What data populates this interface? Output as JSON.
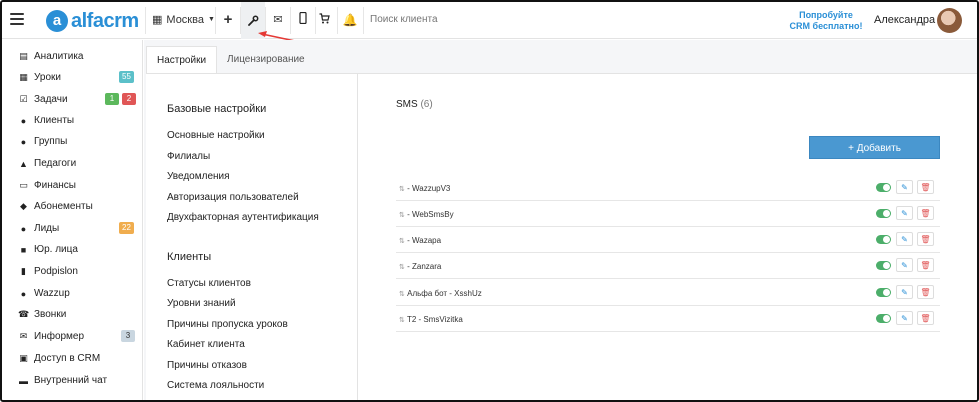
{
  "app": {
    "logo_letter": "a",
    "logo_text": "alfacrm",
    "brand_color": "#2a8fd6"
  },
  "topbar": {
    "city": "Москва",
    "search_placeholder": "Поиск клиента",
    "try_line1": "Попробуйте",
    "try_line2": "CRM бесплатно!",
    "user_name": "Александра",
    "icons": [
      "plus-icon",
      "wrench-icon",
      "mail-icon",
      "phone-icon",
      "cart-icon",
      "bell-icon"
    ]
  },
  "sidebar": {
    "items": [
      {
        "label": "Аналитика",
        "icon": "chart-icon"
      },
      {
        "label": "Уроки",
        "icon": "calendar-icon",
        "badge": "55",
        "badge_color": "#5bc0c9"
      },
      {
        "label": "Задачи",
        "icon": "task-icon",
        "badge": "1",
        "badge_color": "#5cb85c",
        "badge2": "2",
        "badge2_color": "#e05656"
      },
      {
        "label": "Клиенты",
        "icon": "user-icon"
      },
      {
        "label": "Группы",
        "icon": "users-icon"
      },
      {
        "label": "Педагоги",
        "icon": "graduation-icon"
      },
      {
        "label": "Финансы",
        "icon": "money-icon"
      },
      {
        "label": "Абонементы",
        "icon": "tag-icon"
      },
      {
        "label": "Лиды",
        "icon": "user-plus-icon",
        "badge": "22",
        "badge_color": "#f0ad4e"
      },
      {
        "label": "Юр. лица",
        "icon": "briefcase-icon"
      },
      {
        "label": "Podpislon",
        "icon": "document-icon"
      },
      {
        "label": "Wazzup",
        "icon": "whatsapp-icon"
      },
      {
        "label": "Звонки",
        "icon": "phone-icon"
      },
      {
        "label": "Информер",
        "icon": "mail-icon",
        "badge": "3",
        "badge_color": "#c9d6e0"
      },
      {
        "label": "Доступ в CRM",
        "icon": "lock-icon"
      },
      {
        "label": "Внутренний чат",
        "icon": "chat-icon"
      }
    ]
  },
  "tabs": [
    {
      "label": "Настройки",
      "active": true
    },
    {
      "label": "Лицензирование",
      "active": false
    }
  ],
  "settings": {
    "basic_title": "Базовые настройки",
    "basic_links": [
      "Основные настройки",
      "Филиалы",
      "Уведомления",
      "Авторизация пользователей",
      "Двухфакторная аутентификация"
    ],
    "clients_title": "Клиенты",
    "clients_links": [
      "Статусы клиентов",
      "Уровни знаний",
      "Причины пропуска уроков",
      "Кабинет клиента",
      "Причины отказов",
      "Система лояльности"
    ]
  },
  "sms": {
    "title": "SMS",
    "count": "(6)",
    "add_label": "+ Добавить",
    "rows": [
      {
        "label": "- WazzupV3",
        "enabled": true
      },
      {
        "label": "- WebSmsBy",
        "enabled": true
      },
      {
        "label": "- Wazapa",
        "enabled": true
      },
      {
        "label": "- Zanzara",
        "enabled": true
      },
      {
        "label": "Альфа бот - XsshUz",
        "enabled": true
      },
      {
        "label": "T2 - SmsVizitka",
        "enabled": true
      }
    ]
  }
}
